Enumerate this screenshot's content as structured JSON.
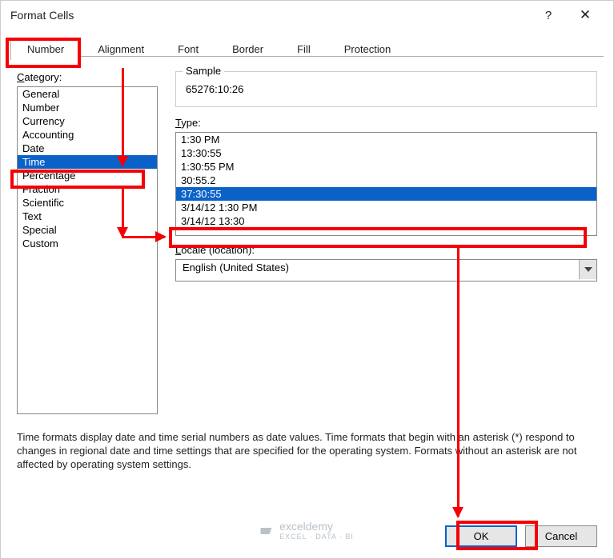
{
  "title": "Format Cells",
  "tabs": [
    "Number",
    "Alignment",
    "Font",
    "Border",
    "Fill",
    "Protection"
  ],
  "active_tab": 0,
  "category_label": "Category:",
  "categories": [
    "General",
    "Number",
    "Currency",
    "Accounting",
    "Date",
    "Time",
    "Percentage",
    "Fraction",
    "Scientific",
    "Text",
    "Special",
    "Custom"
  ],
  "selected_category_index": 5,
  "sample_label": "Sample",
  "sample_value": "65276:10:26",
  "type_label": "Type:",
  "types": [
    "1:30 PM",
    "13:30:55",
    "1:30:55 PM",
    "30:55.2",
    "37:30:55",
    "3/14/12 1:30 PM",
    "3/14/12 13:30"
  ],
  "selected_type_index": 4,
  "locale_label": "Locale (location):",
  "locale_value": "English (United States)",
  "description": "Time formats display date and time serial numbers as date values.  Time formats that begin with an asterisk (*) respond to changes in regional date and time settings that are specified for the operating system. Formats without an asterisk are not affected by operating system settings.",
  "ok_label": "OK",
  "cancel_label": "Cancel",
  "watermark_brand": "exceldemy",
  "watermark_sub": "EXCEL · DATA · BI"
}
